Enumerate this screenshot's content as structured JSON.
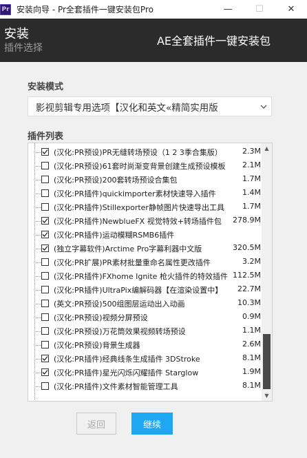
{
  "window": {
    "app_icon": "Pr",
    "title": "安装向导 - Pr全套插件一键安装包Pro",
    "controls": [
      "—",
      "☐",
      "✕"
    ]
  },
  "header": {
    "title": "安装",
    "subtitle": "插件选择",
    "right_title": "AE全套插件一键安装包"
  },
  "mode": {
    "label": "安装模式",
    "selected": "影视剪辑专用选项【汉化和英文«精简实用版"
  },
  "plugins": {
    "label": "插件列表",
    "items": [
      {
        "name": "(汉化:PR预设)PR无缝转场预设（1 2 3季合集版）",
        "size": "2.3M",
        "checked": true
      },
      {
        "name": "(汉化:PR预设)61套时尚渐变背景创建生成预设模板",
        "size": "2.1M",
        "checked": false
      },
      {
        "name": "(汉化:PR预设)200套转场预设合集包",
        "size": "1.7M",
        "checked": false
      },
      {
        "name": "(汉化:PR插件)quickimporter素材快速导入插件",
        "size": "1.4M",
        "checked": false
      },
      {
        "name": "(汉化:PR插件)Stillexporter静帧图片快速导出工具",
        "size": "1.7M",
        "checked": false
      },
      {
        "name": "(汉化:PR插件)NewblueFX 视觉特效+转场插件包",
        "size": "278.9M",
        "checked": true
      },
      {
        "name": "(汉化:PR插件)运动模糊RSMB6插件",
        "size": "",
        "checked": true
      },
      {
        "name": "(独立字幕软件)Arctime Pro字幕利器中文版",
        "size": "320.5M",
        "checked": true
      },
      {
        "name": "(汉化:PR扩展)PR素材批量重命名属性更改插件",
        "size": "3.2M",
        "checked": false
      },
      {
        "name": "(汉化:PR插件)FXhome Ignite 枪火插件的特效插件",
        "size": "112.5M",
        "checked": false
      },
      {
        "name": "(汉化:PR插件)UltraPix编解码器【在渲染设置中】",
        "size": "22.7M",
        "checked": false
      },
      {
        "name": "(英文:PR预设)500组图层运动出入动画",
        "size": "10.3M",
        "checked": false
      },
      {
        "name": "(汉化:PR预设)视频分屏预设",
        "size": "0.9M",
        "checked": false
      },
      {
        "name": "(汉化:PR预设)万花筒效果视频转场预设",
        "size": "1.1M",
        "checked": false
      },
      {
        "name": "(汉化:PR预设)背景生成器",
        "size": "2.6M",
        "checked": false
      },
      {
        "name": "(汉化:PR插件)经典线条生成插件 3DStroke",
        "size": "8.1M",
        "checked": true
      },
      {
        "name": "(汉化:PR插件)星光闪烁闪耀插件 Starglow",
        "size": "1.9M",
        "checked": true
      },
      {
        "name": "(汉化:PR插件)文件素材智能管理工具",
        "size": "8.1M",
        "checked": false
      }
    ]
  },
  "buttons": {
    "back": "返回",
    "next": "继续"
  }
}
